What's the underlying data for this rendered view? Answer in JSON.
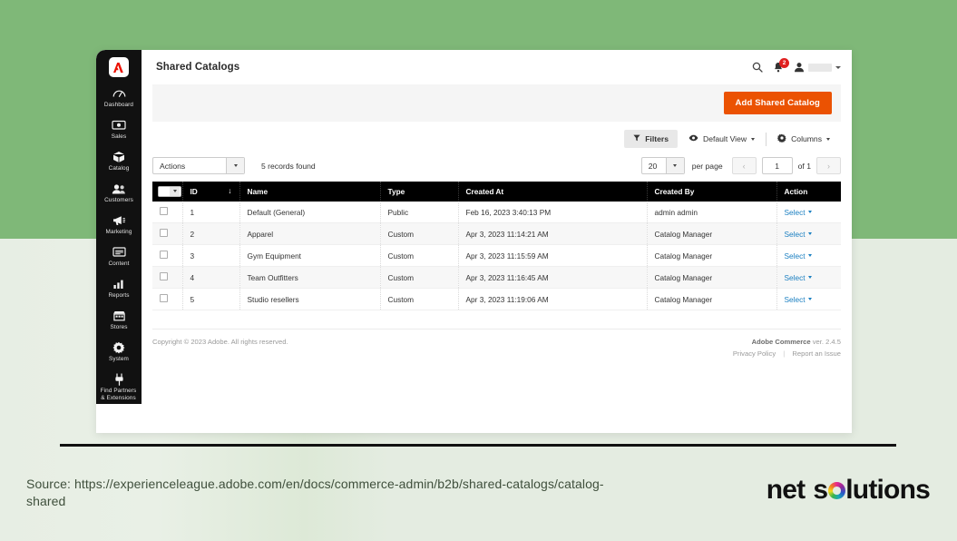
{
  "background": {
    "top_color": "#7fb878",
    "bottom_color": "#e4ece1"
  },
  "sidebar": {
    "logo_name": "adobe-logo",
    "items": [
      {
        "label": "Dashboard",
        "icon": "dashboard-icon"
      },
      {
        "label": "Sales",
        "icon": "sales-icon"
      },
      {
        "label": "Catalog",
        "icon": "catalog-icon"
      },
      {
        "label": "Customers",
        "icon": "customers-icon"
      },
      {
        "label": "Marketing",
        "icon": "marketing-icon"
      },
      {
        "label": "Content",
        "icon": "content-icon"
      },
      {
        "label": "Reports",
        "icon": "reports-icon"
      },
      {
        "label": "Stores",
        "icon": "stores-icon"
      },
      {
        "label": "System",
        "icon": "system-icon"
      },
      {
        "label": "Find Partners\n& Extensions",
        "icon": "extensions-icon"
      }
    ]
  },
  "header": {
    "title": "Shared Catalogs",
    "search_icon": "search-icon",
    "notification_icon": "bell-icon",
    "notification_count": "2",
    "account_icon": "user-icon",
    "account_caret": "chevron-down-icon"
  },
  "action_band": {
    "primary_button": "Add Shared Catalog",
    "primary_color": "#eb5202"
  },
  "controls": {
    "filters_label": "Filters",
    "filters_icon": "funnel-icon",
    "view_label": "Default View",
    "view_icon": "eye-icon",
    "columns_label": "Columns",
    "columns_icon": "gear-icon"
  },
  "toolbar": {
    "actions_label": "Actions",
    "records_found": "5 records found",
    "per_page_value": "20",
    "per_page_label": "per page",
    "prev_label": "‹",
    "next_label": "›",
    "page_value": "1",
    "of_label": "of 1"
  },
  "table": {
    "columns": [
      "ID",
      "Name",
      "Type",
      "Created At",
      "Created By",
      "Action"
    ],
    "sort_column": "ID",
    "sort_indicator": "↓",
    "action_link_label": "Select",
    "rows": [
      {
        "id": "1",
        "name": "Default (General)",
        "type": "Public",
        "created_at": "Feb 16, 2023 3:40:13 PM",
        "created_by": "admin admin",
        "action": "Select"
      },
      {
        "id": "2",
        "name": "Apparel",
        "type": "Custom",
        "created_at": "Apr 3, 2023 11:14:21 AM",
        "created_by": "Catalog Manager",
        "action": "Select"
      },
      {
        "id": "3",
        "name": "Gym Equipment",
        "type": "Custom",
        "created_at": "Apr 3, 2023 11:15:59 AM",
        "created_by": "Catalog Manager",
        "action": "Select"
      },
      {
        "id": "4",
        "name": "Team Outfitters",
        "type": "Custom",
        "created_at": "Apr 3, 2023 11:16:45 AM",
        "created_by": "Catalog Manager",
        "action": "Select"
      },
      {
        "id": "5",
        "name": "Studio resellers",
        "type": "Custom",
        "created_at": "Apr 3, 2023 11:19:06 AM",
        "created_by": "Catalog Manager",
        "action": "Select"
      }
    ]
  },
  "app_footer": {
    "copyright": "Copyright © 2023 Adobe. All rights reserved.",
    "product_name": "Adobe Commerce",
    "version": "ver. 2.4.5",
    "privacy_policy": "Privacy Policy",
    "report_issue": "Report an Issue"
  },
  "caption": {
    "text": "Source: https://experienceleague.adobe.com/en/docs/commerce-admin/b2b/shared-catalogs/catalog-shared"
  },
  "brand": {
    "word1": "net",
    "word2_start": "s",
    "word2_end": "lutions"
  }
}
